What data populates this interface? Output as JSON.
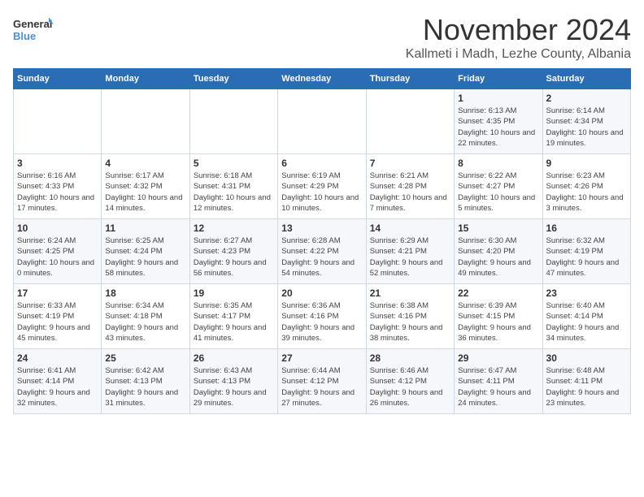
{
  "logo": {
    "line1": "General",
    "line2": "Blue"
  },
  "title": "November 2024",
  "location": "Kallmeti i Madh, Lezhe County, Albania",
  "days_of_week": [
    "Sunday",
    "Monday",
    "Tuesday",
    "Wednesday",
    "Thursday",
    "Friday",
    "Saturday"
  ],
  "weeks": [
    [
      {
        "day": "",
        "detail": ""
      },
      {
        "day": "",
        "detail": ""
      },
      {
        "day": "",
        "detail": ""
      },
      {
        "day": "",
        "detail": ""
      },
      {
        "day": "",
        "detail": ""
      },
      {
        "day": "1",
        "detail": "Sunrise: 6:13 AM\nSunset: 4:35 PM\nDaylight: 10 hours and 22 minutes."
      },
      {
        "day": "2",
        "detail": "Sunrise: 6:14 AM\nSunset: 4:34 PM\nDaylight: 10 hours and 19 minutes."
      }
    ],
    [
      {
        "day": "3",
        "detail": "Sunrise: 6:16 AM\nSunset: 4:33 PM\nDaylight: 10 hours and 17 minutes."
      },
      {
        "day": "4",
        "detail": "Sunrise: 6:17 AM\nSunset: 4:32 PM\nDaylight: 10 hours and 14 minutes."
      },
      {
        "day": "5",
        "detail": "Sunrise: 6:18 AM\nSunset: 4:31 PM\nDaylight: 10 hours and 12 minutes."
      },
      {
        "day": "6",
        "detail": "Sunrise: 6:19 AM\nSunset: 4:29 PM\nDaylight: 10 hours and 10 minutes."
      },
      {
        "day": "7",
        "detail": "Sunrise: 6:21 AM\nSunset: 4:28 PM\nDaylight: 10 hours and 7 minutes."
      },
      {
        "day": "8",
        "detail": "Sunrise: 6:22 AM\nSunset: 4:27 PM\nDaylight: 10 hours and 5 minutes."
      },
      {
        "day": "9",
        "detail": "Sunrise: 6:23 AM\nSunset: 4:26 PM\nDaylight: 10 hours and 3 minutes."
      }
    ],
    [
      {
        "day": "10",
        "detail": "Sunrise: 6:24 AM\nSunset: 4:25 PM\nDaylight: 10 hours and 0 minutes."
      },
      {
        "day": "11",
        "detail": "Sunrise: 6:25 AM\nSunset: 4:24 PM\nDaylight: 9 hours and 58 minutes."
      },
      {
        "day": "12",
        "detail": "Sunrise: 6:27 AM\nSunset: 4:23 PM\nDaylight: 9 hours and 56 minutes."
      },
      {
        "day": "13",
        "detail": "Sunrise: 6:28 AM\nSunset: 4:22 PM\nDaylight: 9 hours and 54 minutes."
      },
      {
        "day": "14",
        "detail": "Sunrise: 6:29 AM\nSunset: 4:21 PM\nDaylight: 9 hours and 52 minutes."
      },
      {
        "day": "15",
        "detail": "Sunrise: 6:30 AM\nSunset: 4:20 PM\nDaylight: 9 hours and 49 minutes."
      },
      {
        "day": "16",
        "detail": "Sunrise: 6:32 AM\nSunset: 4:19 PM\nDaylight: 9 hours and 47 minutes."
      }
    ],
    [
      {
        "day": "17",
        "detail": "Sunrise: 6:33 AM\nSunset: 4:19 PM\nDaylight: 9 hours and 45 minutes."
      },
      {
        "day": "18",
        "detail": "Sunrise: 6:34 AM\nSunset: 4:18 PM\nDaylight: 9 hours and 43 minutes."
      },
      {
        "day": "19",
        "detail": "Sunrise: 6:35 AM\nSunset: 4:17 PM\nDaylight: 9 hours and 41 minutes."
      },
      {
        "day": "20",
        "detail": "Sunrise: 6:36 AM\nSunset: 4:16 PM\nDaylight: 9 hours and 39 minutes."
      },
      {
        "day": "21",
        "detail": "Sunrise: 6:38 AM\nSunset: 4:16 PM\nDaylight: 9 hours and 38 minutes."
      },
      {
        "day": "22",
        "detail": "Sunrise: 6:39 AM\nSunset: 4:15 PM\nDaylight: 9 hours and 36 minutes."
      },
      {
        "day": "23",
        "detail": "Sunrise: 6:40 AM\nSunset: 4:14 PM\nDaylight: 9 hours and 34 minutes."
      }
    ],
    [
      {
        "day": "24",
        "detail": "Sunrise: 6:41 AM\nSunset: 4:14 PM\nDaylight: 9 hours and 32 minutes."
      },
      {
        "day": "25",
        "detail": "Sunrise: 6:42 AM\nSunset: 4:13 PM\nDaylight: 9 hours and 31 minutes."
      },
      {
        "day": "26",
        "detail": "Sunrise: 6:43 AM\nSunset: 4:13 PM\nDaylight: 9 hours and 29 minutes."
      },
      {
        "day": "27",
        "detail": "Sunrise: 6:44 AM\nSunset: 4:12 PM\nDaylight: 9 hours and 27 minutes."
      },
      {
        "day": "28",
        "detail": "Sunrise: 6:46 AM\nSunset: 4:12 PM\nDaylight: 9 hours and 26 minutes."
      },
      {
        "day": "29",
        "detail": "Sunrise: 6:47 AM\nSunset: 4:11 PM\nDaylight: 9 hours and 24 minutes."
      },
      {
        "day": "30",
        "detail": "Sunrise: 6:48 AM\nSunset: 4:11 PM\nDaylight: 9 hours and 23 minutes."
      }
    ]
  ]
}
